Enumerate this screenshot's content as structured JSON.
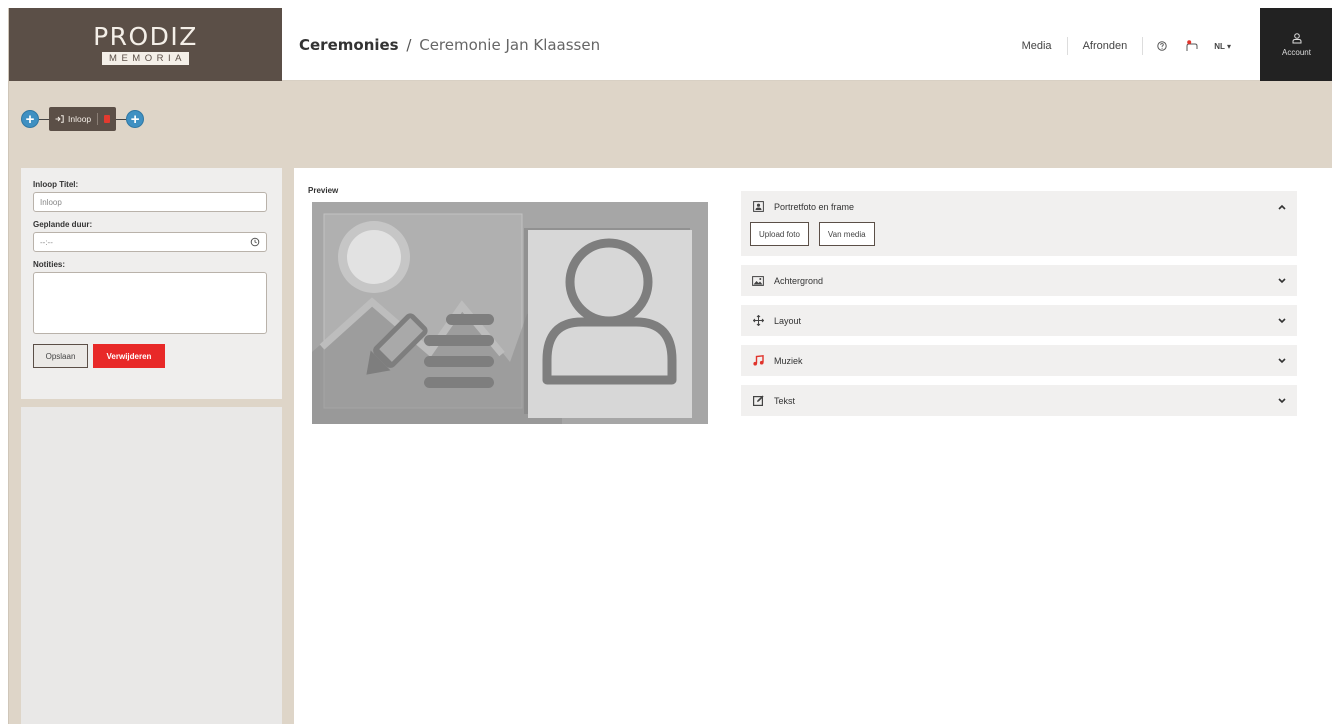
{
  "header": {
    "logo_main": "PRODIZ",
    "logo_sub": "MEMORIA",
    "breadcrumb_root": "Ceremonies",
    "breadcrumb_sep": "/",
    "breadcrumb_current": "Ceremonie Jan Klaassen",
    "nav_media": "Media",
    "nav_finish": "Afronden",
    "language": "NL",
    "account_label": "Account"
  },
  "timeline": {
    "item_label": "Inloop",
    "add_symbol": "+"
  },
  "form": {
    "title_label": "Inloop Titel:",
    "title_value": "Inloop",
    "duration_label": "Geplande duur:",
    "duration_value": "--:--",
    "notes_label": "Notities:",
    "save_label": "Opslaan",
    "delete_label": "Verwijderen"
  },
  "main": {
    "preview_title": "Preview",
    "sections": [
      {
        "label": "Portretfoto en frame",
        "icon": "portrait-frame-icon",
        "expanded": true
      },
      {
        "label": "Achtergrond",
        "icon": "image-icon",
        "expanded": false
      },
      {
        "label": "Layout",
        "icon": "move-icon",
        "expanded": false
      },
      {
        "label": "Muziek",
        "icon": "music-icon",
        "expanded": false
      },
      {
        "label": "Tekst",
        "icon": "edit-text-icon",
        "expanded": false
      }
    ],
    "upload_photo_label": "Upload foto",
    "from_media_label": "Van media"
  },
  "colors": {
    "brand_brown": "#5b4f47",
    "beige_bg": "#ded5c8",
    "accent_blue": "#3f90c2",
    "danger_red": "#e82928",
    "music_red": "#e0332b"
  }
}
